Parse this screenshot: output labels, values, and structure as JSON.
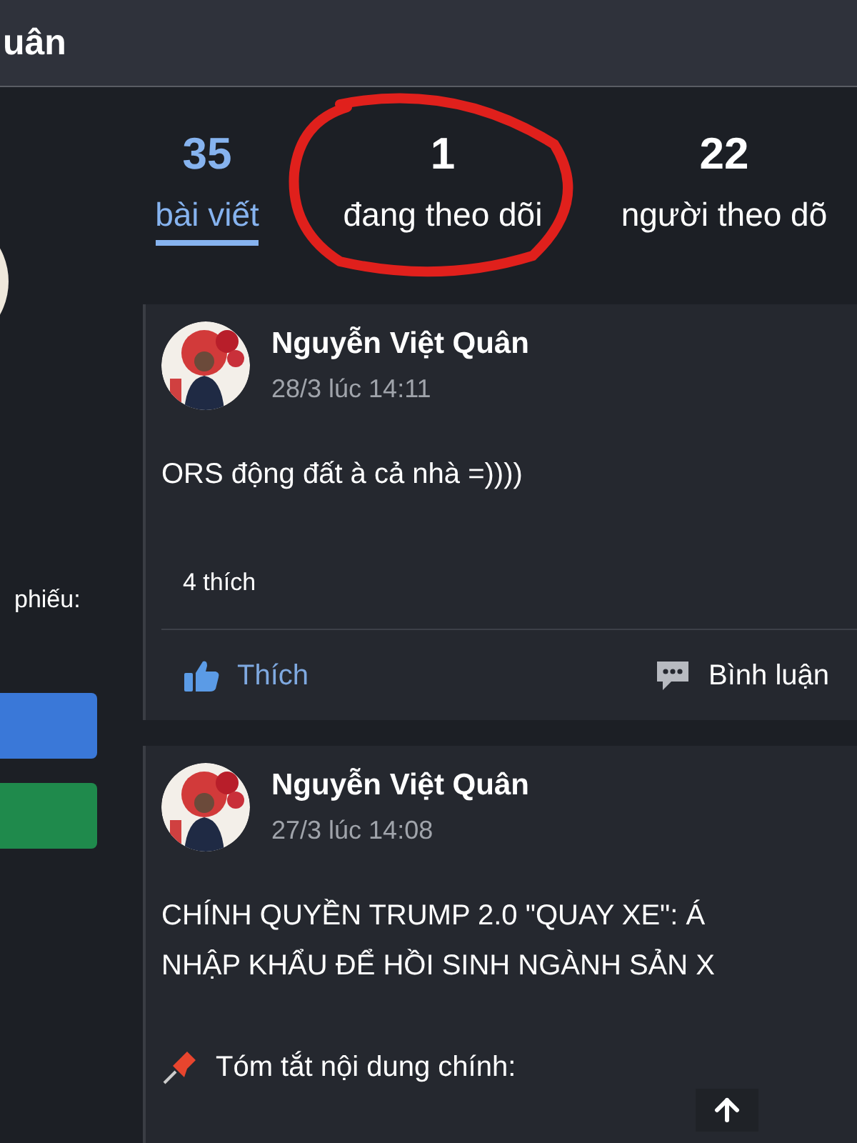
{
  "header": {
    "title": "uân"
  },
  "sidebar": {
    "label": "phiếu:",
    "buttons": [
      {
        "color": "#3a78d8"
      },
      {
        "color": "#1f8a4c"
      }
    ]
  },
  "stats": [
    {
      "count": "35",
      "label": "bài viết",
      "selected": true,
      "circled": false
    },
    {
      "count": "1",
      "label": "đang theo dõi",
      "selected": false,
      "circled": true
    },
    {
      "count": "22",
      "label": "người theo dõ",
      "selected": false,
      "circled": false
    }
  ],
  "posts": [
    {
      "author": "Nguyễn Việt Quân",
      "time": "28/3 lúc 14:11",
      "body": [
        {
          "kind": "text",
          "text": "ORS động đất à cả nhà =))))"
        }
      ],
      "likes": "4 thích",
      "actions": [
        {
          "kind": "like",
          "label": "Thích"
        },
        {
          "kind": "comment",
          "label": "Bình luận"
        }
      ]
    },
    {
      "author": "Nguyễn Việt Quân",
      "time": "27/3 lúc 14:08",
      "body": [
        {
          "kind": "text",
          "text": "CHÍNH QUYỀN TRUMP 2.0 \"QUAY XE\": Á"
        },
        {
          "kind": "text",
          "text": "NHẬP KHẨU ĐỂ HỒI SINH NGÀNH SẢN X"
        },
        {
          "kind": "blank"
        },
        {
          "kind": "pinned",
          "text": "Tóm tắt nội dung chính:"
        }
      ]
    }
  ]
}
